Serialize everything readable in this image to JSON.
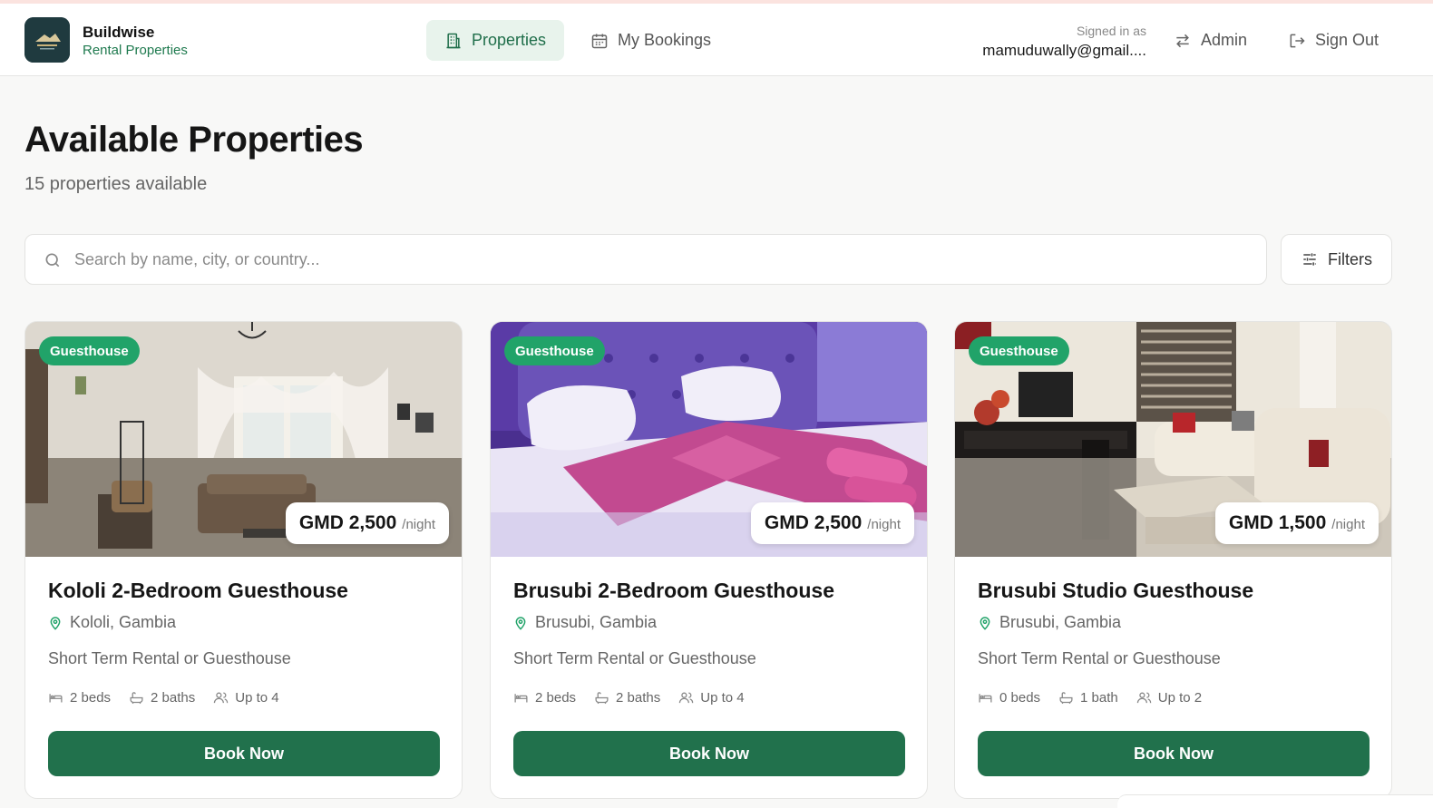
{
  "brand": {
    "name": "Buildwise",
    "subtitle": "Rental Properties"
  },
  "nav": {
    "properties": "Properties",
    "bookings": "My Bookings",
    "signed_in_label": "Signed in as",
    "email": "mamuduwally@gmail....",
    "admin": "Admin",
    "sign_out": "Sign Out"
  },
  "main": {
    "title": "Available Properties",
    "count": "15 properties available",
    "search_placeholder": "Search by name, city, or country...",
    "filters": "Filters"
  },
  "properties": [
    {
      "tag": "Guesthouse",
      "price": "GMD 2,500",
      "unit": "/night",
      "title": "Kololi 2-Bedroom Guesthouse",
      "location": "Kololi, Gambia",
      "description": "Short Term Rental or Guesthouse",
      "beds": "2 beds",
      "baths": "2 baths",
      "guests": "Up to 4",
      "cta": "Book Now"
    },
    {
      "tag": "Guesthouse",
      "price": "GMD 2,500",
      "unit": "/night",
      "title": "Brusubi 2-Bedroom Guesthouse",
      "location": "Brusubi, Gambia",
      "description": "Short Term Rental or Guesthouse",
      "beds": "2 beds",
      "baths": "2 baths",
      "guests": "Up to 4",
      "cta": "Book Now"
    },
    {
      "tag": "Guesthouse",
      "price": "GMD 1,500",
      "unit": "/night",
      "title": "Brusubi Studio Guesthouse",
      "location": "Brusubi, Gambia",
      "description": "Short Term Rental or Guesthouse",
      "beds": "0 beds",
      "baths": "1 bath",
      "guests": "Up to 2",
      "cta": "Book Now"
    }
  ],
  "colors": {
    "accent": "#21714c",
    "tag": "#21a369",
    "nav_active_bg": "#e8f3ec",
    "brand_subtitle": "#1f7a4f"
  },
  "icons": {
    "properties": "building-icon",
    "bookings": "calendar-icon",
    "admin": "switch-arrows-icon",
    "sign_out": "logout-icon",
    "search": "search-icon",
    "filters": "sliders-icon",
    "location": "map-pin-icon",
    "beds": "bed-icon",
    "baths": "bath-icon",
    "guests": "users-icon"
  }
}
